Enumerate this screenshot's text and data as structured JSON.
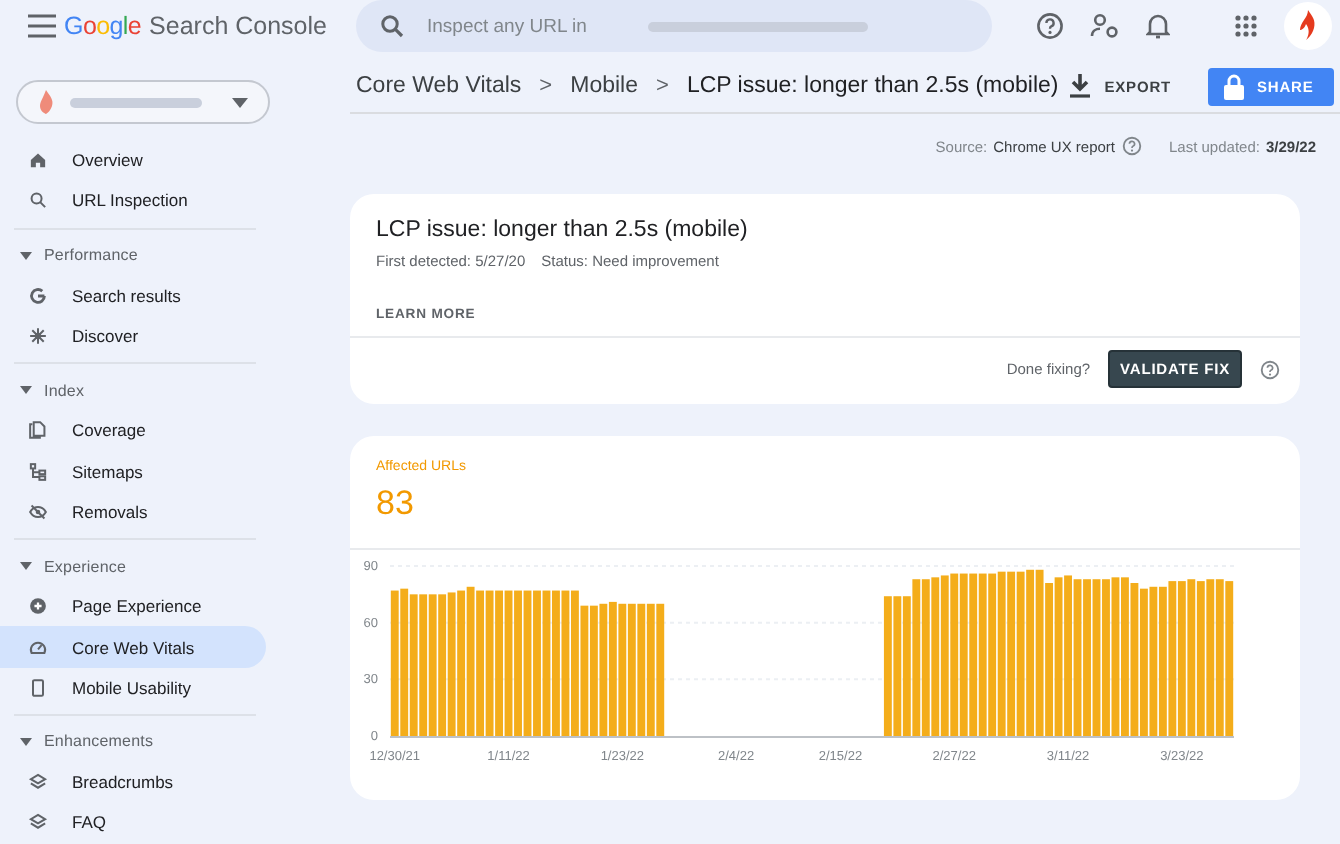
{
  "header": {
    "logo": {
      "brand": "Google",
      "product": "Search Console"
    },
    "search": {
      "placeholder": "Inspect any URL in"
    }
  },
  "property_selector": {
    "expanded": false
  },
  "sidebar": {
    "items": [
      {
        "label": "Overview",
        "selected": false
      },
      {
        "label": "URL Inspection",
        "selected": false
      }
    ],
    "sections": [
      {
        "title": "Performance",
        "expanded": true,
        "items": [
          {
            "label": "Search results",
            "selected": false
          },
          {
            "label": "Discover",
            "selected": false
          }
        ]
      },
      {
        "title": "Index",
        "expanded": true,
        "items": [
          {
            "label": "Coverage",
            "selected": false
          },
          {
            "label": "Sitemaps",
            "selected": false
          },
          {
            "label": "Removals",
            "selected": false
          }
        ]
      },
      {
        "title": "Experience",
        "expanded": true,
        "items": [
          {
            "label": "Page Experience",
            "selected": false
          },
          {
            "label": "Core Web Vitals",
            "selected": true
          },
          {
            "label": "Mobile Usability",
            "selected": false
          }
        ]
      },
      {
        "title": "Enhancements",
        "expanded": true,
        "items": [
          {
            "label": "Breadcrumbs",
            "selected": false
          },
          {
            "label": "FAQ",
            "selected": false
          }
        ]
      }
    ]
  },
  "breadcrumb": {
    "items": [
      "Core Web Vitals",
      "Mobile",
      "LCP issue: longer than 2.5s (mobile)"
    ],
    "separators": [
      ">",
      ">"
    ]
  },
  "actions": {
    "export": "EXPORT",
    "share": "SHARE"
  },
  "source": {
    "label": "Source:",
    "value": "Chrome UX report",
    "updated_label": "Last updated:",
    "updated_value": "3/29/22"
  },
  "issue": {
    "title": "LCP issue: longer than 2.5s (mobile)",
    "first_detected": "First detected: 5/27/20",
    "status": "Status: Need improvement",
    "learn_more": "LEARN MORE",
    "done_fixing": "Done fixing?",
    "validate": "VALIDATE FIX"
  },
  "affected": {
    "label": "Affected URLs",
    "count": "83",
    "chart_data": {
      "type": "bar",
      "color": "#f4ad1a",
      "categories": [
        "12/30/21",
        null,
        null,
        null,
        null,
        null,
        null,
        null,
        null,
        null,
        null,
        null,
        "1/11/22",
        null,
        null,
        null,
        null,
        null,
        null,
        null,
        null,
        null,
        null,
        null,
        "1/23/22",
        null,
        null,
        null,
        null,
        null,
        null,
        null,
        null,
        null,
        null,
        null,
        "2/4/22",
        null,
        null,
        null,
        null,
        null,
        null,
        null,
        null,
        null,
        null,
        "2/15/22",
        null,
        null,
        null,
        null,
        null,
        null,
        null,
        null,
        null,
        null,
        null,
        "2/27/22",
        null,
        null,
        null,
        null,
        null,
        null,
        null,
        null,
        null,
        null,
        null,
        "3/11/22",
        null,
        null,
        null,
        null,
        null,
        null,
        null,
        null,
        null,
        null,
        null,
        "3/23/22",
        null,
        null,
        null,
        null,
        null
      ],
      "values": [
        77,
        78,
        75,
        75,
        75,
        75,
        76,
        77,
        79,
        77,
        77,
        77,
        77,
        77,
        77,
        77,
        77,
        77,
        77,
        77,
        69,
        69,
        70,
        71,
        70,
        70,
        70,
        70,
        70,
        null,
        null,
        null,
        null,
        null,
        null,
        null,
        null,
        null,
        null,
        null,
        null,
        null,
        null,
        null,
        null,
        null,
        null,
        null,
        null,
        null,
        null,
        null,
        74,
        74,
        74,
        83,
        83,
        84,
        85,
        86,
        86,
        86,
        86,
        86,
        87,
        87,
        87,
        88,
        88,
        81,
        84,
        85,
        83,
        83,
        83,
        83,
        84,
        84,
        81,
        78,
        79,
        79,
        82,
        82,
        83,
        82,
        83,
        83,
        82
      ],
      "ylim": [
        0,
        90
      ],
      "yticks": [
        0,
        30,
        60,
        90
      ]
    }
  }
}
